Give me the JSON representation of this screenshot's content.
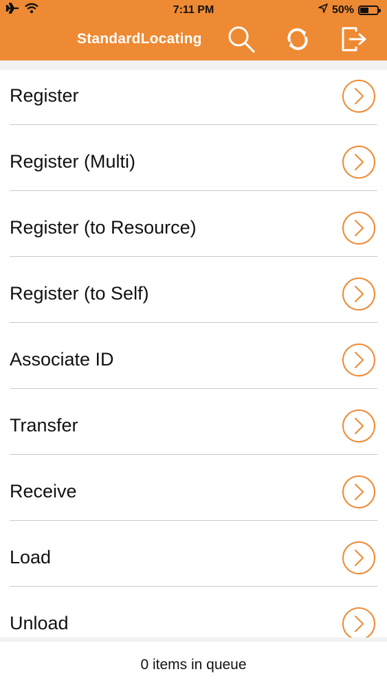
{
  "status_bar": {
    "time": "7:11 PM",
    "battery": "50%",
    "battery_level": 0.5
  },
  "header": {
    "title": "StandardLocating",
    "accent_color": "#ee8a33",
    "icons": [
      "search-icon",
      "sync-icon",
      "logout-icon"
    ]
  },
  "menu": {
    "items": [
      {
        "label": "Register"
      },
      {
        "label": "Register (Multi)"
      },
      {
        "label": "Register (to Resource)"
      },
      {
        "label": "Register (to Self)"
      },
      {
        "label": "Associate ID"
      },
      {
        "label": "Transfer"
      },
      {
        "label": "Receive"
      },
      {
        "label": "Load"
      },
      {
        "label": "Unload"
      }
    ]
  },
  "footer": {
    "queue_text": "0 items in queue"
  }
}
